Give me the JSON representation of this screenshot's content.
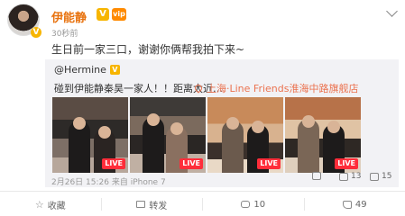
{
  "post": {
    "username": "伊能静",
    "time": "30秒前",
    "text": "生日前一家三口，谢谢你俩帮我拍下来~"
  },
  "repost": {
    "user": "@Hermine",
    "text": "碰到伊能静秦昊一家人！！距离太近…",
    "location": "上海·Line Friends淮海中路旗舰店",
    "photos": [
      {
        "live": "LIVE"
      },
      {
        "live": "LIVE"
      },
      {
        "live": "LIVE"
      },
      {
        "live": "LIVE"
      }
    ],
    "meta": "2月26日 15:26 来自 iPhone 7",
    "share_count": "",
    "comment_count": "13",
    "like_count": "15"
  },
  "actions": {
    "favorite": "收藏",
    "forward": "转发",
    "comment": "10",
    "like": "49"
  },
  "colors": {
    "accent": "#e8720e",
    "link": "#eb7350",
    "live": "#ff2d3a"
  }
}
